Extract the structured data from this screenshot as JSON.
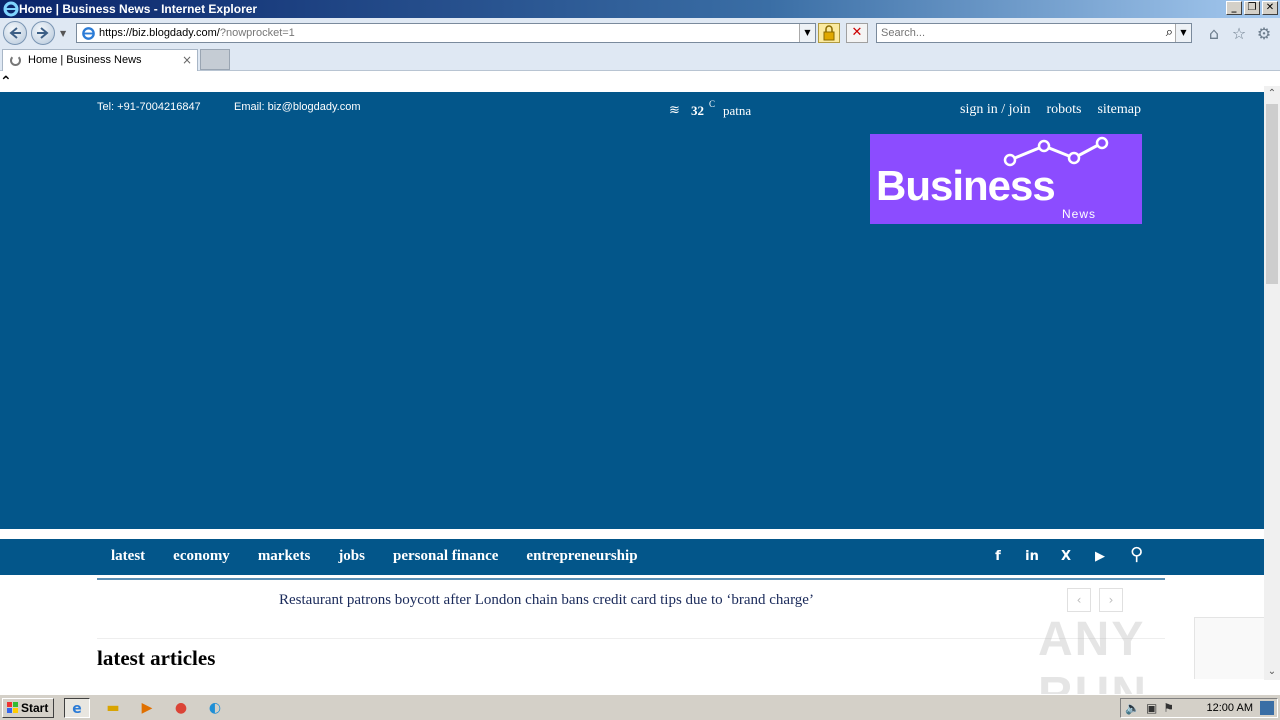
{
  "window": {
    "title": "Home | Business News - Internet Explorer",
    "controls": [
      "_",
      "❐",
      "✕"
    ]
  },
  "browser": {
    "url_main": "https://biz.blogdady.com/",
    "url_rest": "?nowprocket=1",
    "search_placeholder": "Search...",
    "tab_title": "Home | Business News",
    "tab_close": "×"
  },
  "site": {
    "topbar": {
      "tel": "Tel: +91-7004216847",
      "email": "Email: biz@blogdady.com"
    },
    "weather": {
      "temp": "32",
      "unit": "C",
      "city": "patna"
    },
    "top_links": [
      "sign in / join",
      "robots",
      "sitemap"
    ],
    "logo": {
      "text": "Business",
      "subtext": "News"
    },
    "menu": [
      "latest",
      "economy",
      "markets",
      "jobs",
      "personal finance",
      "entrepreneurship"
    ],
    "social": [
      "f",
      "in",
      "X",
      "▶"
    ],
    "ticker_headline": "Restaurant patrons boycott after London chain bans credit card tips due to ‘brand charge’",
    "section_title": "latest articles"
  },
  "watermark": "ANY RUN",
  "taskbar": {
    "start": "Start",
    "clock": "12:00 AM"
  },
  "colors": {
    "header_bg": "#03568a",
    "logo_bg": "#8c4cff"
  }
}
